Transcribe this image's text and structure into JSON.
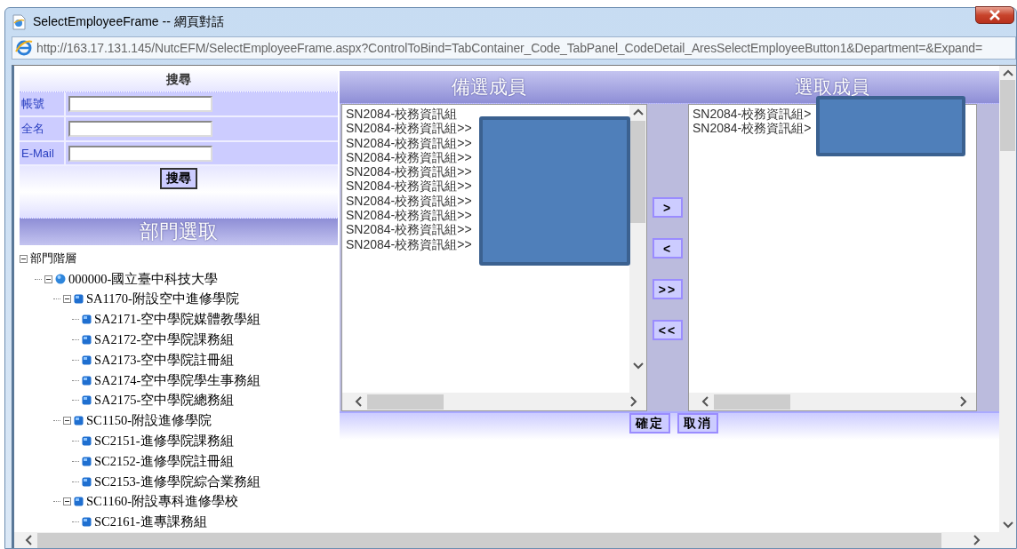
{
  "window": {
    "title": "SelectEmployeeFrame -- 網頁對話"
  },
  "address_bar": {
    "url": "http://163.17.131.145/NutcEFM/SelectEmployeeFrame.aspx?ControlToBind=TabContainer_Code_TabPanel_CodeDetail_AresSelectEmployeeButton1&Department=&Expand="
  },
  "search": {
    "title": "搜尋",
    "fields": [
      {
        "label": "帳號"
      },
      {
        "label": "全名"
      },
      {
        "label": "E-Mail"
      }
    ],
    "button": "搜尋"
  },
  "department": {
    "title": "部門選取",
    "tree": [
      {
        "label": "部門階層",
        "kind": "folder",
        "expanded": true,
        "children": [
          {
            "label": "000000-國立臺中科技大學",
            "kind": "campus",
            "expanded": true,
            "children": [
              {
                "label": "SA1170-附設空中進修學院",
                "kind": "unit",
                "expanded": true,
                "children": [
                  {
                    "label": "SA2171-空中學院媒體教學組",
                    "kind": "unit"
                  },
                  {
                    "label": "SA2172-空中學院課務組",
                    "kind": "unit"
                  },
                  {
                    "label": "SA2173-空中學院註冊組",
                    "kind": "unit"
                  },
                  {
                    "label": "SA2174-空中學院學生事務組",
                    "kind": "unit"
                  },
                  {
                    "label": "SA2175-空中學院總務組",
                    "kind": "unit"
                  }
                ]
              },
              {
                "label": "SC1150-附設進修學院",
                "kind": "unit",
                "expanded": true,
                "children": [
                  {
                    "label": "SC2151-進修學院課務組",
                    "kind": "unit"
                  },
                  {
                    "label": "SC2152-進修學院註冊組",
                    "kind": "unit"
                  },
                  {
                    "label": "SC2153-進修學院綜合業務組",
                    "kind": "unit"
                  }
                ]
              },
              {
                "label": "SC1160-附設專科進修學校",
                "kind": "unit",
                "expanded": true,
                "children": [
                  {
                    "label": "SC2161-進專課務組",
                    "kind": "unit"
                  }
                ]
              }
            ]
          }
        ]
      }
    ]
  },
  "candidates": {
    "title": "備選成員",
    "items": [
      "SN2084-校務資訊組",
      "SN2084-校務資訊組>>",
      "SN2084-校務資訊組>>",
      "SN2084-校務資訊組>>",
      "SN2084-校務資訊組>>",
      "SN2084-校務資訊組>>",
      "SN2084-校務資訊組>>",
      "SN2084-校務資訊組>>",
      "SN2084-校務資訊組>>",
      "SN2084-校務資訊組>>"
    ]
  },
  "transfer_buttons": [
    ">",
    "<",
    ">>",
    "<<"
  ],
  "chosen": {
    "title": "選取成員",
    "items": [
      "SN2084-校務資訊組>",
      "SN2084-校務資訊組>"
    ]
  },
  "footer_buttons": [
    "確定",
    "取消"
  ]
}
